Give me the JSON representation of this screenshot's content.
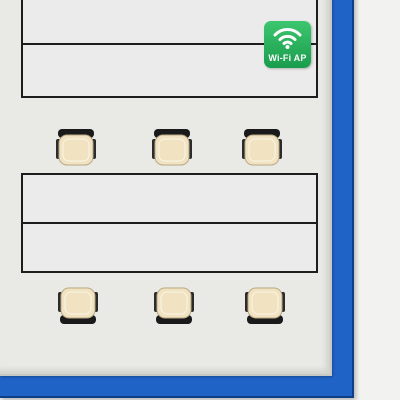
{
  "wifi_ap": {
    "label": "Wi-Fi AP",
    "color": "#22a854",
    "icon": "wifi-icon"
  },
  "colors": {
    "wall": "#1f63c6",
    "floor": "#e9e9e5",
    "table_fill": "#ebebeb",
    "table_border": "#1d1d1d",
    "chair_seat": "#f1e3c2",
    "chair_back": "#1a1a1a"
  },
  "tables": [
    {
      "id": "table-top"
    },
    {
      "id": "table-bottom"
    }
  ],
  "chairs": [
    {
      "id": "chair-1",
      "row": "middle",
      "facing": "up"
    },
    {
      "id": "chair-2",
      "row": "middle",
      "facing": "up"
    },
    {
      "id": "chair-3",
      "row": "middle",
      "facing": "up"
    },
    {
      "id": "chair-4",
      "row": "bottom",
      "facing": "down"
    },
    {
      "id": "chair-5",
      "row": "bottom",
      "facing": "down"
    },
    {
      "id": "chair-6",
      "row": "bottom",
      "facing": "down"
    }
  ]
}
